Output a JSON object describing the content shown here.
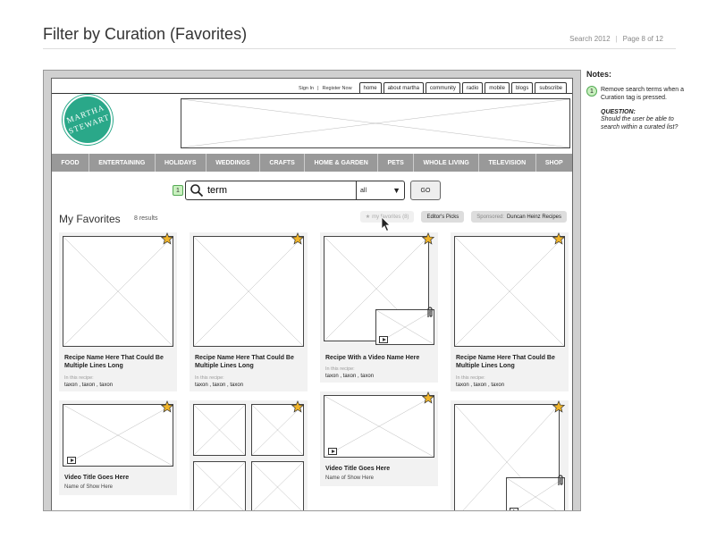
{
  "page": {
    "title": "Filter by Curation (Favorites)",
    "project": "Search 2012",
    "page_label": "Page 8 of 12"
  },
  "header": {
    "sign_in": "Sign In",
    "link_sep": "|",
    "register": "Register Now",
    "tabs": [
      "home",
      "about martha",
      "community",
      "radio",
      "mobile",
      "blogs",
      "subscribe"
    ],
    "logo_line1": "MARTHA",
    "logo_line2": "STEWART"
  },
  "categories": [
    "FOOD",
    "ENTERTAINING",
    "HOLIDAYS",
    "WEDDINGS",
    "CRAFTS",
    "HOME & GARDEN",
    "PETS",
    "WHOLE LIVING",
    "TELEVISION",
    "SHOP"
  ],
  "search": {
    "badge": "1",
    "value": "term",
    "scope": "all",
    "go_label": "GO"
  },
  "favorites": {
    "title": "My Favorites",
    "count": "8 results",
    "filters": {
      "my_favorites": "my favorites (8)",
      "editors_picks": "Editor's Picks",
      "sponsored_prefix": "Sponsored:",
      "sponsored_name": "Duncan Heinz Recipes"
    }
  },
  "cards": {
    "recipe1": {
      "title": "Recipe Name Here That Could Be Multiple Lines Long",
      "sub": "In this recipe:",
      "tax": "taxon , taxon , taxon"
    },
    "recipe2": {
      "title": "Recipe Name Here That Could Be Multiple Lines Long",
      "sub": "In this recipe:",
      "tax": "taxon , taxon , taxon"
    },
    "recipe_video": {
      "title": "Recipe With a Video Name Here",
      "sub": "In this recipe:",
      "tax": "taxon , taxon , taxon"
    },
    "recipe4": {
      "title": "Recipe Name Here That Could Be Multiple Lines Long",
      "sub": "In this recipe:",
      "tax": "taxon , taxon , taxon"
    },
    "video1": {
      "title": "Video Title Goes Here",
      "show": "Name of Show Here"
    },
    "video2": {
      "title": "Video Title Goes Here",
      "show": "Name of Show Here"
    }
  },
  "notes": {
    "title": "Notes:",
    "item_num": "1",
    "item_text": "Remove search terms when a Curation tag is pressed.",
    "question_label": "QUESTION:",
    "question_text": "Should the user be able to search within a curated list?"
  },
  "colors": {
    "logo": "#2aa889",
    "nav_bar": "#999999",
    "star": "#f0b429",
    "badge": "#c9f0bf"
  }
}
